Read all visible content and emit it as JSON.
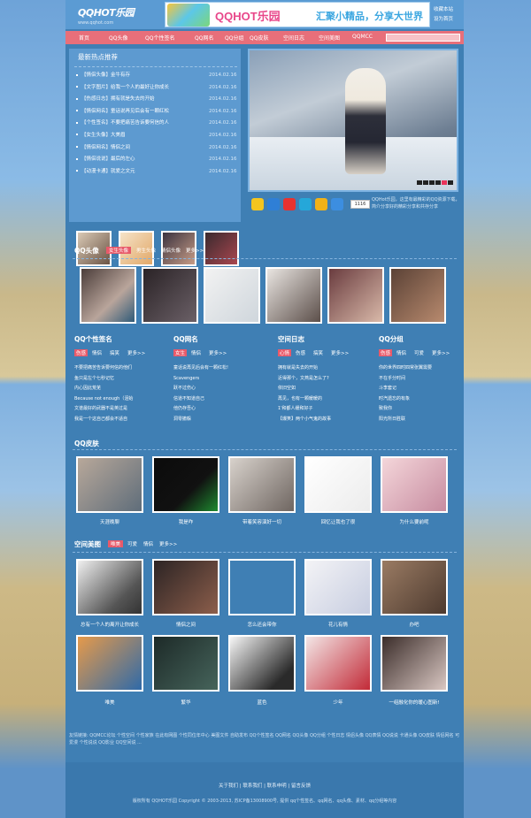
{
  "header": {
    "logo_text": "QQHOT乐园",
    "logo_url": "www.qqhot.com",
    "banner_title": "QQHOT乐园",
    "banner_slogan": "汇聚小精品，分享大世界",
    "links": [
      "收藏本站",
      "设为首页"
    ]
  },
  "nav": {
    "items": [
      "首页",
      "QQ头像",
      "QQ个性签名",
      "QQ网名",
      "QQ分组",
      "QQ皮肤",
      "空间日志",
      "空间美图",
      "QQMCC"
    ]
  },
  "hot": {
    "title": "最新热点推荐",
    "items": [
      {
        "text": "【情侣头像】金牛有存",
        "date": "2014.02.16"
      },
      {
        "text": "【文字图片】给我一个人的最好让你成长",
        "date": "2014.02.16"
      },
      {
        "text": "【伤感日志】拥有就是失去的开始",
        "date": "2014.02.16"
      },
      {
        "text": "【情侣网名】童话说再见后会有一颗红松",
        "date": "2014.02.16"
      },
      {
        "text": "【个性签名】不要把痛苦告诉要何信的人",
        "date": "2014.02.16"
      },
      {
        "text": "【女生头像】大美眉",
        "date": "2014.02.16"
      },
      {
        "text": "【情侣网名】情侣之间",
        "date": "2014.02.16"
      },
      {
        "text": "【情侣说说】最后的左心",
        "date": "2014.02.16"
      },
      {
        "text": "【动漫卡通】就爱之文元",
        "date": "2014.02.16"
      }
    ]
  },
  "share": {
    "count": "1116"
  },
  "about_text": "QQHot乐园，这里有最精彩的QQ资源下载，简介分享好的精彩分享和共存分享",
  "qq_avatar": {
    "title": "QQ头像",
    "tags": [
      "女生头像",
      "男生头像",
      "情侣头像",
      "更多>>"
    ]
  },
  "columns": [
    {
      "title": "QQ个性签名",
      "tags": [
        "伤感",
        "情侣",
        "搞笑",
        "更多>>"
      ],
      "items": [
        "不要把痛苦告诉要何信的他们",
        "鱼只是左个七秒记忆",
        "内心因此荒芜",
        "Because not enough（泪始",
        "文谱最好的武器不是英过是",
        "我是一个这自己都会不适自"
      ]
    },
    {
      "title": "QQ网名",
      "tags": [
        "女生",
        "情侣",
        "更多>>"
      ],
      "items": [
        "童话说再见后会有一颗红松!",
        "Scavengers",
        "跃不过伤心",
        "信道不知道自己",
        "他仍存吾心",
        "洞零撤躲"
      ]
    },
    {
      "title": "空间日志",
      "tags": [
        "心情",
        "伤感",
        "搞笑",
        "更多>>"
      ],
      "items": [
        "拥有就是失去的开始",
        "近得那个，文燕是怎么了?",
        "依旧空如",
        "再见，也有一颗暖暖的",
        "1'和都人缓和好子",
        "【爆笑】两个小气鬼的故事"
      ]
    },
    {
      "title": "QQ分组",
      "tags": [
        "伤感",
        "情侣",
        "可爱",
        "更多>>"
      ],
      "items": [
        "你的世界四时四常张翼需要",
        "不在乎分时间",
        "斗李套记",
        "时汽遗忘的有象",
        "致我你",
        "阳光所日胜联"
      ]
    }
  ],
  "qq_skin": {
    "title": "QQ皮肤",
    "captions": [
      "天涯晚聊",
      "我是咋",
      "带着笑容演好一切",
      "回忆让我也了很",
      "为什么要前呢"
    ]
  },
  "space_pics": {
    "title": "空间美图",
    "tags": [
      "唯美",
      "可爱",
      "情侣",
      "更多>>"
    ],
    "captions_row1": [
      "总有一个人的离开让你成长",
      "情侣之间",
      "怎么还会带你",
      "花儿有情",
      "办吧"
    ],
    "captions_row2": [
      "唯美",
      "繁华",
      "蓝色",
      "少年",
      "一组融化你的暖心图新!"
    ]
  },
  "footer": {
    "friend_links": "友情链接:  QQMCC论坛  个性空间  个性家族  在此有网图  个性同位年中心  美图文件  自助发布  QQ个性签名  QQ网名  QQ头像  QQ分组  个性日志  情侣头像  QQ表情  QQ说说  卡通头像  QQ皮肤  情侣网名  可爱漫  个性说说  QQ影业  QQ空间说 ...",
    "nav_links": "关于我们  |  联系我们  |  联系申明  |  留言反馈",
    "copyright": "版权所有 QQHOT乐园 Copyright © 2003-2013, 苏ICP备13008900号, 提供 qq个性签名、qq网名、qq头像、素材、qq分组等内容"
  },
  "colors": {
    "page_bg": "#6ea3d8",
    "main_bg": "#3f7fb4",
    "nav_bg": "#e86f7a",
    "accent_tag": "#e85a6a"
  }
}
